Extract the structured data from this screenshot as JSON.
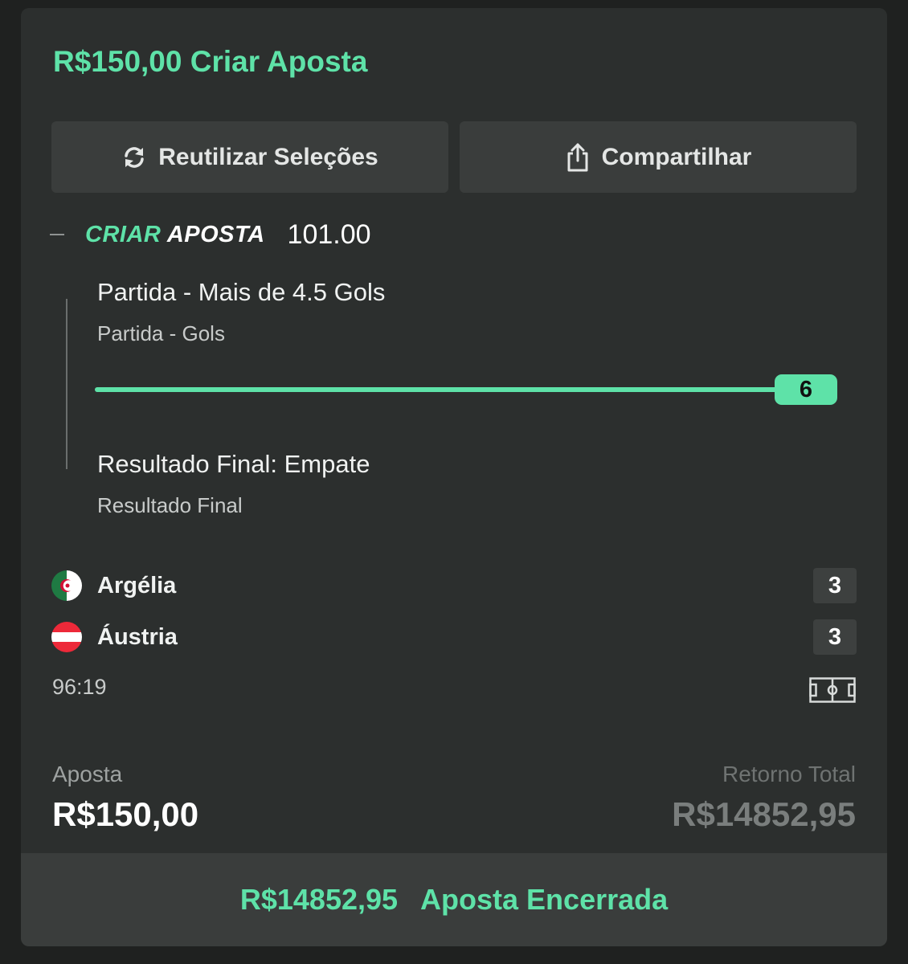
{
  "header": {
    "title": "R$150,00 Criar Aposta"
  },
  "actions": {
    "reuse_label": "Reutilizar Seleções",
    "share_label": "Compartilhar"
  },
  "bet_builder": {
    "logo_part1": "CRIAR",
    "logo_part2": "APOSTA",
    "odds": "101.00"
  },
  "selections": [
    {
      "title": "Partida - Mais de 4.5 Gols",
      "market": "Partida - Gols",
      "progress_value": "6",
      "progress_fraction": 1.0
    },
    {
      "title": "Resultado Final: Empate",
      "market": "Resultado Final"
    }
  ],
  "match": {
    "teams": [
      {
        "name": "Argélia",
        "score": "3",
        "flag_icon": "algeria-flag-icon"
      },
      {
        "name": "Áustria",
        "score": "3",
        "flag_icon": "austria-flag-icon"
      }
    ],
    "time": "96:19"
  },
  "summary": {
    "stake_label": "Aposta",
    "stake_value": "R$150,00",
    "return_label": "Retorno Total",
    "return_value": "R$14852,95"
  },
  "footer": {
    "amount": "R$14852,95",
    "status": "Aposta Encerrada"
  },
  "colors": {
    "accent": "#5ee2a8",
    "card_bg": "#2c2f2e",
    "page_bg": "#1f2120"
  }
}
